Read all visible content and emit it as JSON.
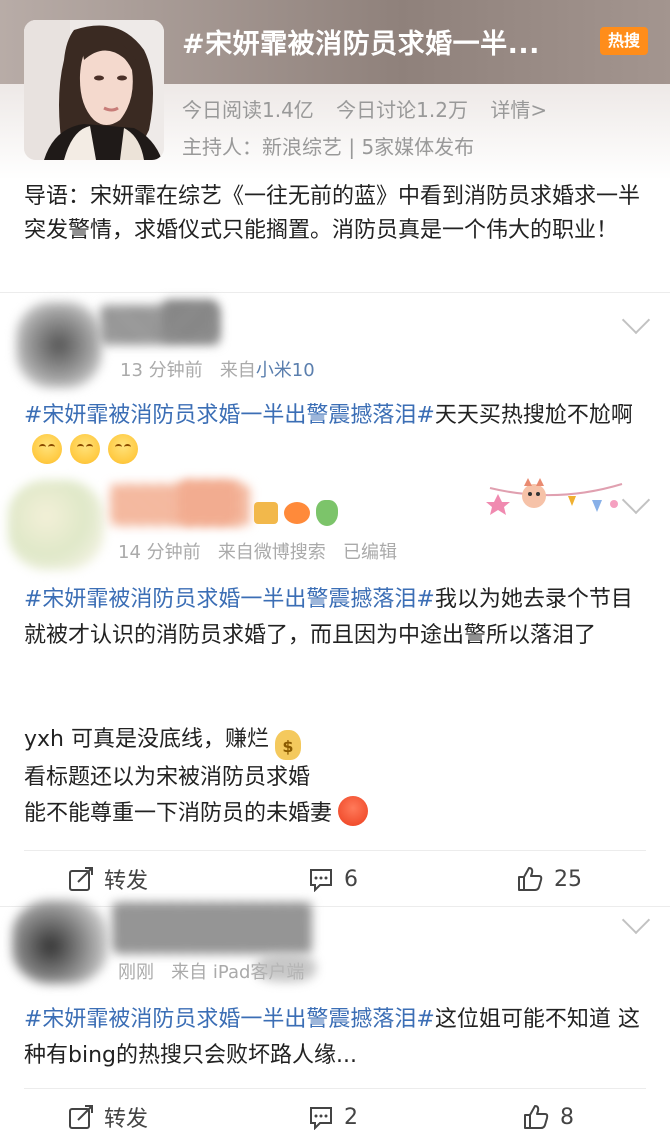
{
  "topic": {
    "title": "#宋妍霏被消防员求婚一半...",
    "badge": "热搜",
    "reads": "今日阅读1.4亿",
    "discussions": "今日讨论1.2万",
    "detail_link": "详情>",
    "host": "主持人：新浪综艺 | 5家媒体发布",
    "intro": "导语：宋妍霏在综艺《一往无前的蓝》中看到消防员求婚求一半突发警情，求婚仪式只能搁置。消防员真是一个伟大的职业！"
  },
  "posts": [
    {
      "time": "13 分钟前",
      "from_label": "来自",
      "source": "小米10",
      "hashtag": "#宋妍霏被消防员求婚一半出警震撼落泪#",
      "text": "天天买热搜尬不尬啊"
    },
    {
      "time": "14 分钟前",
      "from_label": "来自",
      "source": "微博搜索",
      "edited": "已编辑",
      "hashtag": "#宋妍霏被消防员求婚一半出警震撼落泪#",
      "text": "我以为她去录个节目就被才认识的消防员求婚了，而且因为中途出警所以落泪了",
      "line1": "yxh 可真是没底线，赚烂",
      "line2": "看标题还以为宋被消防员求婚",
      "line3": "能不能尊重一下消防员的未婚妻",
      "actions": {
        "repost": "转发",
        "comments": "6",
        "likes": "25"
      }
    },
    {
      "time": "刚刚",
      "from_label": "来自",
      "source": "iPad客户端",
      "hashtag": "#宋妍霏被消防员求婚一半出警震撼落泪#",
      "text": "这位姐可能不知道 这种有bing的热搜只会败坏路人缘...",
      "actions": {
        "repost": "转发",
        "comments": "2",
        "likes": "8"
      }
    }
  ],
  "colors": {
    "hashtag": "#3b6eb5",
    "badge": "#ff8d1a",
    "meta": "#aaaaaa"
  }
}
